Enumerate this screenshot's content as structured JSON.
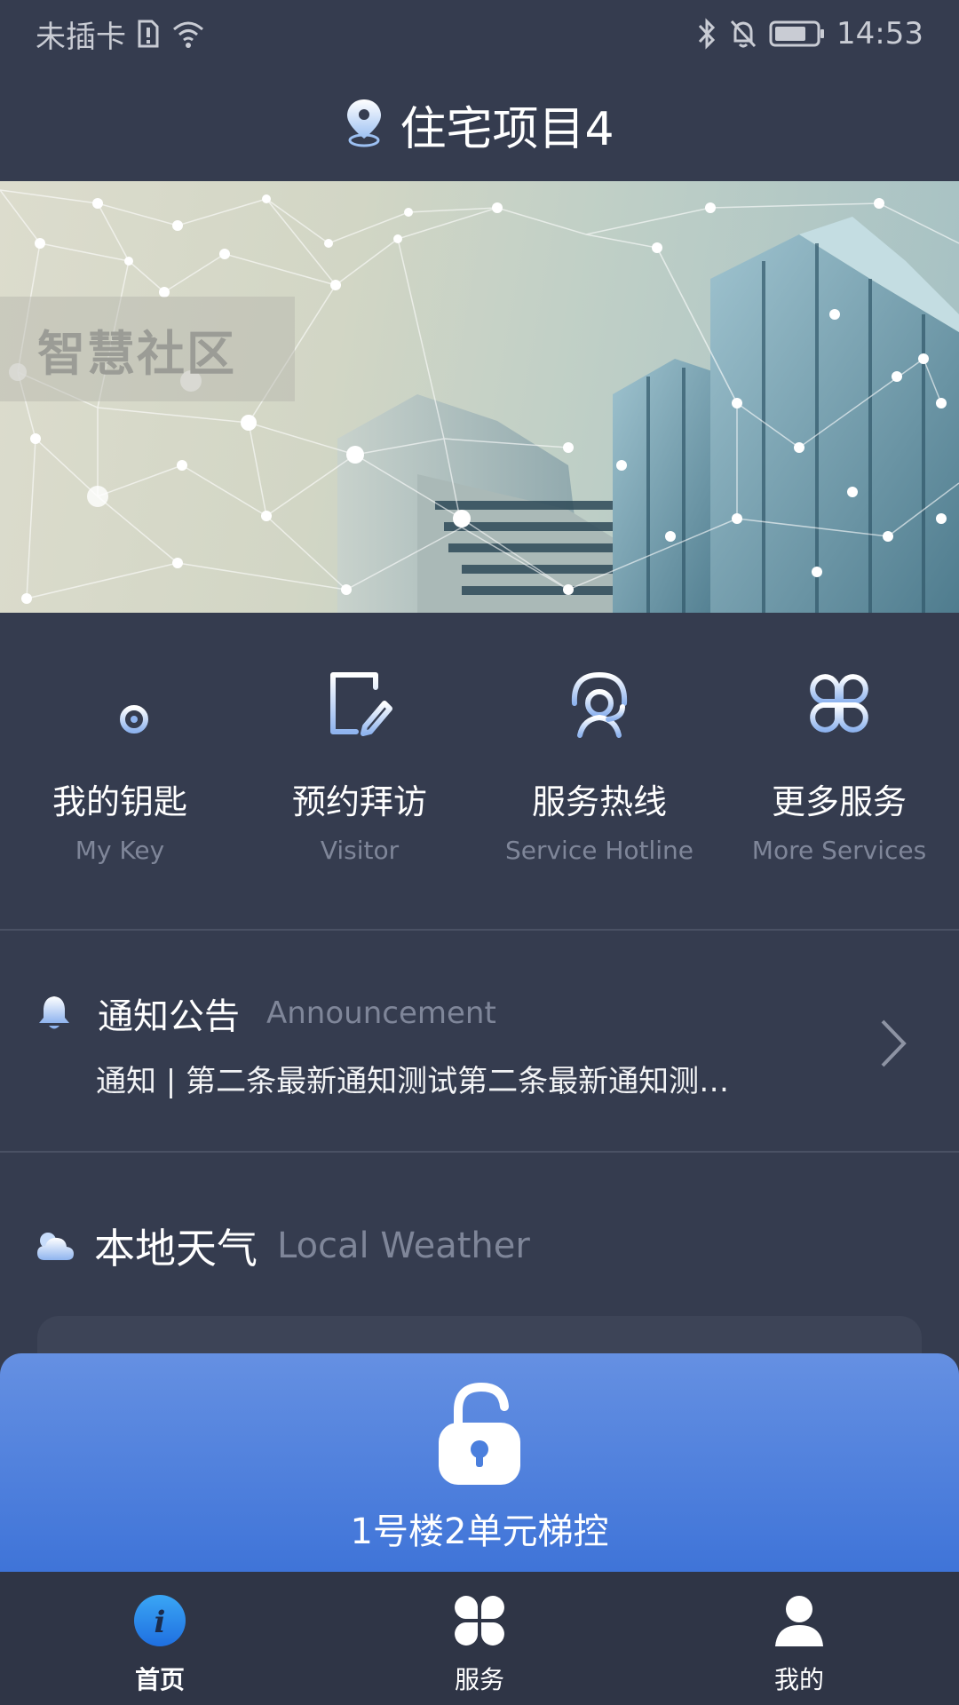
{
  "status_bar": {
    "carrier": "未插卡",
    "time": "14:53",
    "icons": [
      "sim-alert-icon",
      "wifi-icon",
      "bluetooth-icon",
      "bell-muted-icon",
      "battery-icon"
    ]
  },
  "header": {
    "title": "住宅项目4",
    "icon": "location-pin-icon"
  },
  "banner": {
    "tag": "智慧社区"
  },
  "quick_actions": [
    {
      "label": "我的钥匙",
      "sub": "My Key",
      "icon": "key-icon"
    },
    {
      "label": "预约拜访",
      "sub": "Visitor",
      "icon": "edit-document-icon"
    },
    {
      "label": "服务热线",
      "sub": "Service Hotline",
      "icon": "headset-icon"
    },
    {
      "label": "更多服务",
      "sub": "More Services",
      "icon": "grid-icon"
    }
  ],
  "announcement": {
    "title": "通知公告",
    "sub": "Announcement",
    "body": "通知 | 第二条最新通知测试第二条最新通知测…",
    "icon": "bell-icon"
  },
  "weather": {
    "title": "本地天气",
    "sub": "Local Weather",
    "icon": "cloud-sun-icon"
  },
  "unlock": {
    "label": "1号楼2单元梯控",
    "icon": "unlock-icon"
  },
  "bottom_nav": [
    {
      "label": "首页",
      "icon": "info-icon",
      "active": true
    },
    {
      "label": "服务",
      "icon": "grid-icon",
      "active": false
    },
    {
      "label": "我的",
      "icon": "user-icon",
      "active": false
    }
  ],
  "colors": {
    "background": "#353c4f",
    "accent": "#4a7fe0",
    "muted_text": "#7f8699",
    "nav_bg": "#2f3546"
  }
}
